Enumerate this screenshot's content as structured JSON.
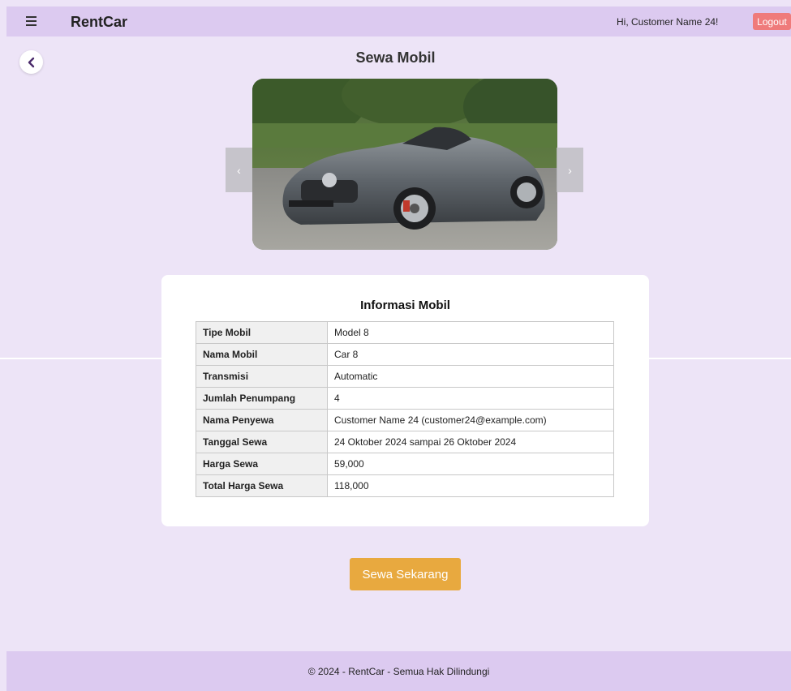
{
  "header": {
    "brand": "RentCar",
    "greeting": "Hi, Customer Name 24!",
    "logout_label": "Logout"
  },
  "page": {
    "title": "Sewa Mobil"
  },
  "carousel": {
    "prev_label": "‹",
    "next_label": "›"
  },
  "info": {
    "title": "Informasi Mobil",
    "rows": [
      {
        "label": "Tipe Mobil",
        "value": "Model 8"
      },
      {
        "label": "Nama Mobil",
        "value": "Car 8"
      },
      {
        "label": "Transmisi",
        "value": "Automatic"
      },
      {
        "label": "Jumlah Penumpang",
        "value": "4"
      },
      {
        "label": "Nama Penyewa",
        "value": "Customer Name 24 (customer24@example.com)"
      },
      {
        "label": "Tanggal Sewa",
        "value": "24 Oktober 2024 sampai 26 Oktober 2024"
      },
      {
        "label": "Harga Sewa",
        "value": "59,000"
      },
      {
        "label": "Total Harga Sewa",
        "value": "118,000"
      }
    ]
  },
  "actions": {
    "rent_label": "Sewa Sekarang"
  },
  "footer": {
    "text": "© 2024 - RentCar - Semua Hak Dilindungi"
  },
  "icons": {
    "menu": "hamburger-menu-icon",
    "back": "chevron-left-icon"
  },
  "colors": {
    "background": "#ede4f7",
    "navbar": "#dccaf0",
    "logout": "#ef7b7b",
    "cta": "#e8a93f"
  }
}
